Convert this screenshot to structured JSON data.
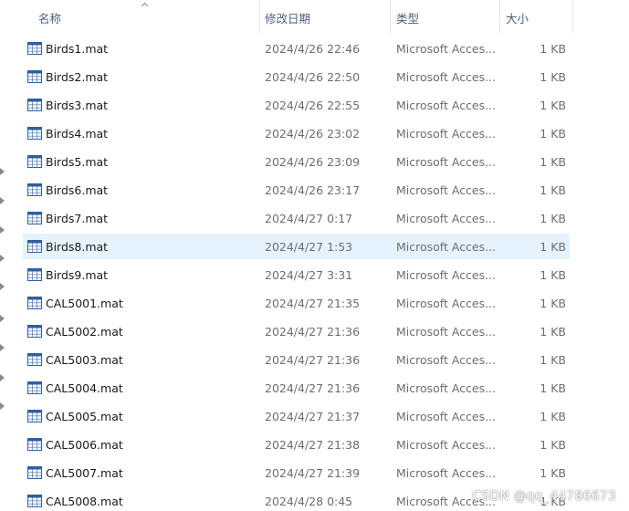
{
  "columns": {
    "name": "名称",
    "date": "修改日期",
    "type": "类型",
    "size": "大小"
  },
  "files": [
    {
      "name": "Birds1.mat",
      "date": "2024/4/26 22:46",
      "type": "Microsoft Acces...",
      "size": "1 KB"
    },
    {
      "name": "Birds2.mat",
      "date": "2024/4/26 22:50",
      "type": "Microsoft Acces...",
      "size": "1 KB"
    },
    {
      "name": "Birds3.mat",
      "date": "2024/4/26 22:55",
      "type": "Microsoft Acces...",
      "size": "1 KB"
    },
    {
      "name": "Birds4.mat",
      "date": "2024/4/26 23:02",
      "type": "Microsoft Acces...",
      "size": "1 KB"
    },
    {
      "name": "Birds5.mat",
      "date": "2024/4/26 23:09",
      "type": "Microsoft Acces...",
      "size": "1 KB"
    },
    {
      "name": "Birds6.mat",
      "date": "2024/4/26 23:17",
      "type": "Microsoft Acces...",
      "size": "1 KB"
    },
    {
      "name": "Birds7.mat",
      "date": "2024/4/27 0:17",
      "type": "Microsoft Acces...",
      "size": "1 KB"
    },
    {
      "name": "Birds8.mat",
      "date": "2024/4/27 1:53",
      "type": "Microsoft Acces...",
      "size": "1 KB",
      "selected": true
    },
    {
      "name": "Birds9.mat",
      "date": "2024/4/27 3:31",
      "type": "Microsoft Acces...",
      "size": "1 KB"
    },
    {
      "name": "CAL5001.mat",
      "date": "2024/4/27 21:35",
      "type": "Microsoft Acces...",
      "size": "1 KB"
    },
    {
      "name": "CAL5002.mat",
      "date": "2024/4/27 21:36",
      "type": "Microsoft Acces...",
      "size": "1 KB"
    },
    {
      "name": "CAL5003.mat",
      "date": "2024/4/27 21:36",
      "type": "Microsoft Acces...",
      "size": "1 KB"
    },
    {
      "name": "CAL5004.mat",
      "date": "2024/4/27 21:36",
      "type": "Microsoft Acces...",
      "size": "1 KB"
    },
    {
      "name": "CAL5005.mat",
      "date": "2024/4/27 21:37",
      "type": "Microsoft Acces...",
      "size": "1 KB"
    },
    {
      "name": "CAL5006.mat",
      "date": "2024/4/27 21:38",
      "type": "Microsoft Acces...",
      "size": "1 KB"
    },
    {
      "name": "CAL5007.mat",
      "date": "2024/4/27 21:39",
      "type": "Microsoft Acces...",
      "size": "1 KB"
    },
    {
      "name": "CAL5008.mat",
      "date": "2024/4/28 0:45",
      "type": "Microsoft Acces...",
      "size": "1 KB"
    }
  ],
  "file_icon": "access-table-icon",
  "colors": {
    "header_text": "#4c607a",
    "selected_row": "#e5f3ff",
    "secondary_text": "#6d6d6d"
  },
  "watermark": "CSDN @qq_44786673"
}
